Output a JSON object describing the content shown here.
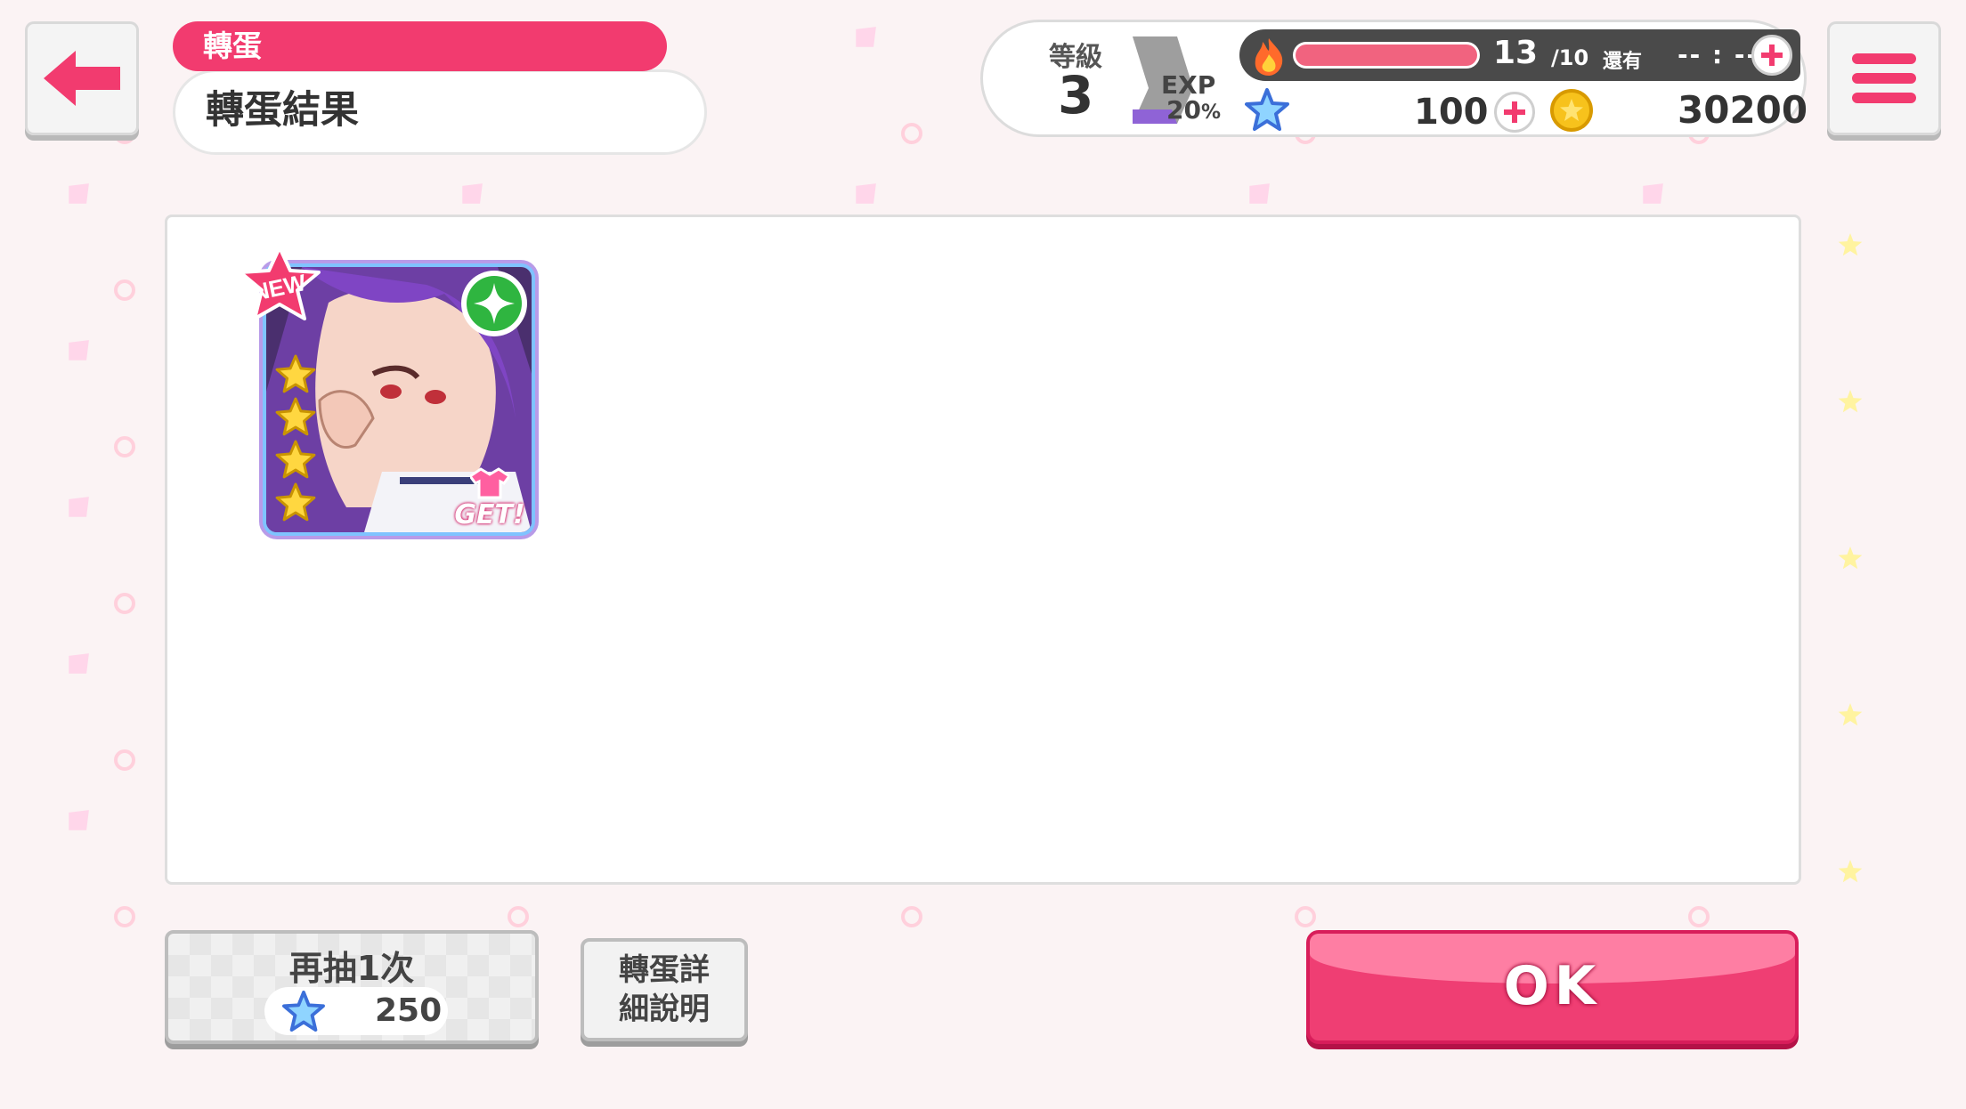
{
  "header": {
    "category": "轉蛋",
    "title": "轉蛋結果"
  },
  "status": {
    "level_label": "等級",
    "level": "3",
    "exp_label": "EXP",
    "exp_percent": "20",
    "exp_percent_unit": "%",
    "stamina_value": "13",
    "stamina_max": "/10",
    "stamina_fill_fraction": 1.0,
    "remaining_label": "還有",
    "remaining_time": "-- : --",
    "gems": "100",
    "coins": "30200"
  },
  "result": {
    "card": {
      "new_badge": "NEW",
      "rarity_stars": 4,
      "get_badge": "GET!"
    }
  },
  "buttons": {
    "retry_label": "再抽1次",
    "retry_cost": "250",
    "detail_line1": "轉蛋詳",
    "detail_line2": "細說明",
    "ok_label": "OK"
  },
  "colors": {
    "accent": "#f23b6f",
    "ok_button": "#ef3e73",
    "background": "#fbf3f4"
  }
}
